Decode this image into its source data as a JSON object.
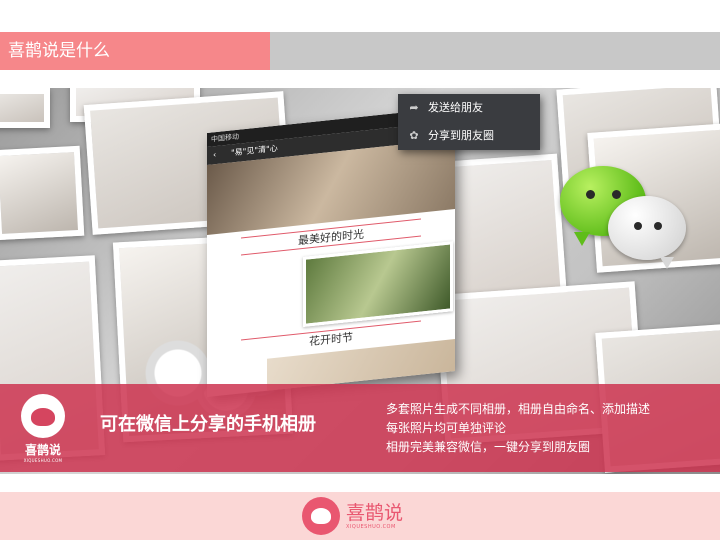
{
  "header": {
    "title": "喜鹊说是什么"
  },
  "phone": {
    "status_text": "中国移动",
    "back_icon": "chevron-left-icon",
    "nav_title": "\"易\"见\"清\"心",
    "caption1": "最美好的时光",
    "caption2": "花开时节"
  },
  "share_menu": {
    "items": [
      {
        "icon": "share-arrow-icon",
        "label": "发送给朋友"
      },
      {
        "icon": "moments-icon",
        "label": "分享到朋友圈"
      }
    ]
  },
  "wechat_logo": {
    "icon": "wechat-icon",
    "color_primary": "#5fbd1a",
    "color_secondary": "#ffffff"
  },
  "banner": {
    "logo_name": "喜鹊说",
    "logo_sub": "XIQUESHUO.COM",
    "headline": "可在微信上分享的手机相册",
    "features": [
      "多套照片生成不同相册，相册自由命名、添加描述",
      "每张照片均可单独评论",
      "相册完美兼容微信，一键分享到朋友圈"
    ],
    "color": "#cd3652"
  },
  "footer": {
    "logo_name": "喜鹊说",
    "logo_sub": "XIQUESHUO.COM",
    "color": "#e95770"
  }
}
